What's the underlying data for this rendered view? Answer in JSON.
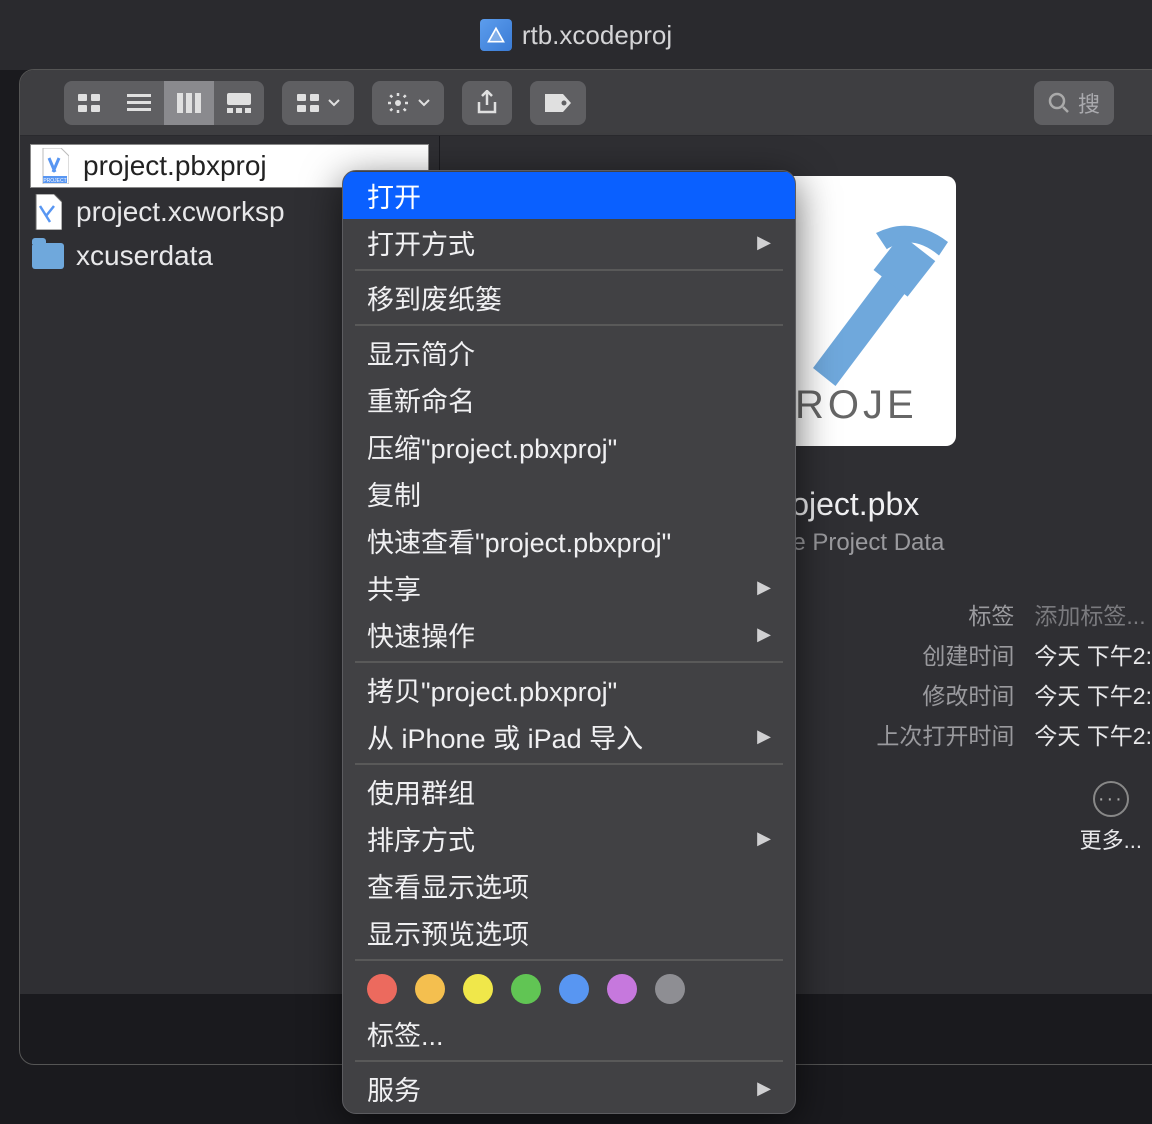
{
  "titlebar": {
    "filename": "rtb.xcodeproj"
  },
  "toolbar": {
    "search_placeholder": "搜"
  },
  "files": [
    {
      "name": "project.pbxproj",
      "type": "file",
      "selected": true
    },
    {
      "name": "project.xcworksp",
      "type": "file",
      "selected": false
    },
    {
      "name": "xcuserdata",
      "type": "folder",
      "selected": false
    }
  ],
  "context_menu": {
    "open": "打开",
    "open_with": "打开方式",
    "move_to_trash": "移到废纸篓",
    "get_info": "显示简介",
    "rename": "重新命名",
    "compress": "压缩\"project.pbxproj\"",
    "duplicate": "复制",
    "quick_look": "快速查看\"project.pbxproj\"",
    "share": "共享",
    "quick_actions": "快速操作",
    "copy": "拷贝\"project.pbxproj\"",
    "import_from": "从 iPhone 或 iPad 导入",
    "use_groups": "使用群组",
    "sort_by": "排序方式",
    "show_view_options": "查看显示选项",
    "show_preview_options": "显示预览选项",
    "tags": "标签...",
    "services": "服务"
  },
  "tag_colors": [
    "#ec6a5e",
    "#f4bf4f",
    "#f0e74a",
    "#61c554",
    "#5896f2",
    "#c678dd",
    "#8e8e93"
  ],
  "preview": {
    "icon_label": "PROJE",
    "filename": "project.pbx",
    "kind": "Xcode Project Data",
    "labels": {
      "tags": "标签",
      "created": "创建时间",
      "modified": "修改时间",
      "last_opened": "上次打开时间"
    },
    "values": {
      "tags_placeholder": "添加标签...",
      "created": "今天 下午2:",
      "modified": "今天 下午2:",
      "last_opened": "今天 下午2:"
    },
    "more": "更多..."
  }
}
